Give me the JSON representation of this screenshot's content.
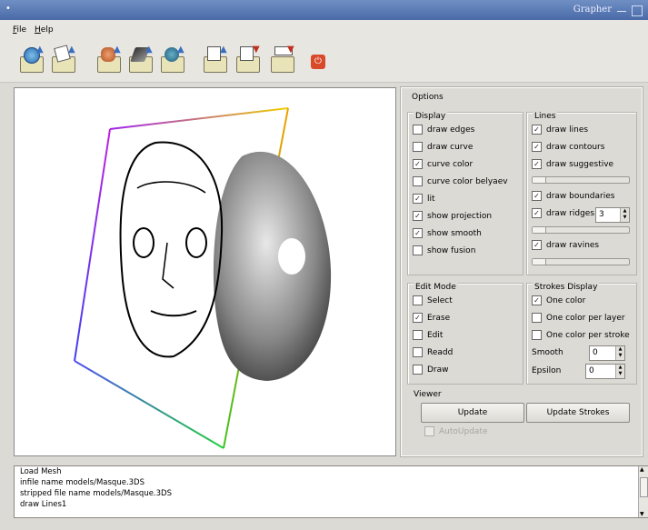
{
  "window": {
    "title": "Grapher",
    "icon": "app-dot-icon"
  },
  "menu": {
    "file": "File",
    "help": "Help"
  },
  "toolbar": {
    "buttons": [
      {
        "name": "open-mesh-button",
        "icon": "globe-folder-icon"
      },
      {
        "name": "open-sketch-button",
        "icon": "sketch-folder-icon"
      },
      {
        "name": "open-head-button",
        "icon": "head-folder-icon"
      },
      {
        "name": "open-shape-button",
        "icon": "shape-folder-icon"
      },
      {
        "name": "open-blob-button",
        "icon": "blob-folder-icon"
      },
      {
        "name": "load-strokes-button",
        "icon": "document-folder-icon"
      },
      {
        "name": "save-strokes-button",
        "icon": "document-save-icon"
      },
      {
        "name": "export-button",
        "icon": "export-folder-icon"
      },
      {
        "name": "quit-button",
        "icon": "power-icon"
      }
    ]
  },
  "options": {
    "title": "Options",
    "display": {
      "title": "Display",
      "items": [
        {
          "label": "draw edges",
          "checked": false
        },
        {
          "label": "draw curve",
          "checked": false
        },
        {
          "label": "curve color",
          "checked": true
        },
        {
          "label": "curve color belyaev",
          "checked": false
        },
        {
          "label": "lit",
          "checked": true
        },
        {
          "label": "show projection",
          "checked": true
        },
        {
          "label": "show smooth",
          "checked": true
        },
        {
          "label": "show fusion",
          "checked": false
        }
      ]
    },
    "lines": {
      "title": "Lines",
      "draw_lines": "draw lines",
      "draw_contours": "draw contours",
      "draw_suggestive": "draw suggestive",
      "draw_boundaries": "draw boundaries",
      "draw_ridges": "draw ridges",
      "ridges_value": "3",
      "draw_ravines": "draw ravines"
    },
    "edit_mode": {
      "title": "Edit Mode",
      "items": [
        {
          "label": "Select",
          "checked": false
        },
        {
          "label": "Erase",
          "checked": true
        },
        {
          "label": "Edit",
          "checked": false
        },
        {
          "label": "Readd",
          "checked": false
        },
        {
          "label": "Draw",
          "checked": false
        }
      ]
    },
    "strokes_display": {
      "title": "Strokes Display",
      "one_color": "One color",
      "one_color_per_layer": "One color per layer",
      "one_color_per_stroke": "One color per stroke",
      "smooth_label": "Smooth",
      "smooth_value": "0",
      "epsilon_label": "Epsilon",
      "epsilon_value": "0"
    },
    "viewer": {
      "title": "Viewer",
      "update": "Update",
      "update_strokes": "Update Strokes",
      "auto_update": "AutoUpdate"
    }
  },
  "log": {
    "lines": [
      "Load Mesh",
      "infile name models/Masque.3DS",
      "stripped file name models/Masque.3DS",
      "draw Lines1"
    ]
  }
}
